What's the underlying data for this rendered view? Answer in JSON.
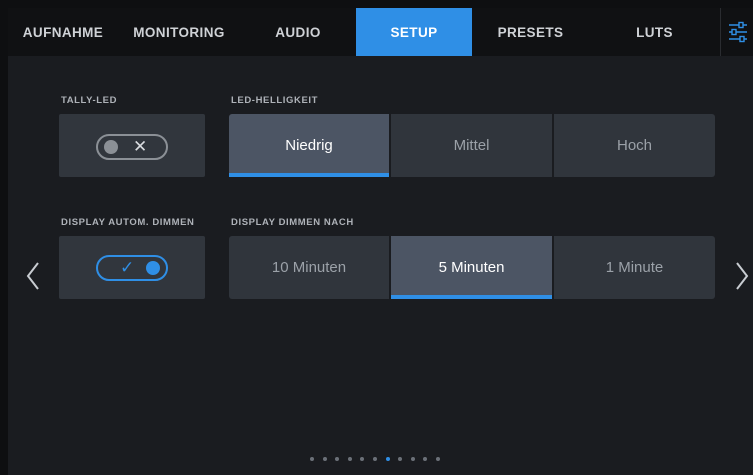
{
  "tabs": [
    {
      "label": "AUFNAHME",
      "active": false
    },
    {
      "label": "MONITORING",
      "active": false
    },
    {
      "label": "AUDIO",
      "active": false
    },
    {
      "label": "SETUP",
      "active": true
    },
    {
      "label": "PRESETS",
      "active": false
    },
    {
      "label": "LUTS",
      "active": false
    }
  ],
  "settings_icon": "sliders-icon",
  "tally": {
    "label": "TALLY-LED",
    "enabled": false,
    "mark": "✕"
  },
  "led_brightness": {
    "label": "LED-HELLIGKEIT",
    "options": [
      "Niedrig",
      "Mittel",
      "Hoch"
    ],
    "selected": "Niedrig"
  },
  "auto_dim": {
    "label": "DISPLAY AUTOM. DIMMEN",
    "enabled": true,
    "mark": "✓"
  },
  "dim_after": {
    "label": "DISPLAY DIMMEN NACH",
    "options": [
      "10 Minuten",
      "5 Minuten",
      "1 Minute"
    ],
    "selected": "5 Minuten"
  },
  "pagination": {
    "total": 11,
    "current": 7
  },
  "colors": {
    "accent": "#2f8fe6",
    "background": "#1a1c20",
    "panel": "#31363d",
    "selected": "#4c5564"
  }
}
